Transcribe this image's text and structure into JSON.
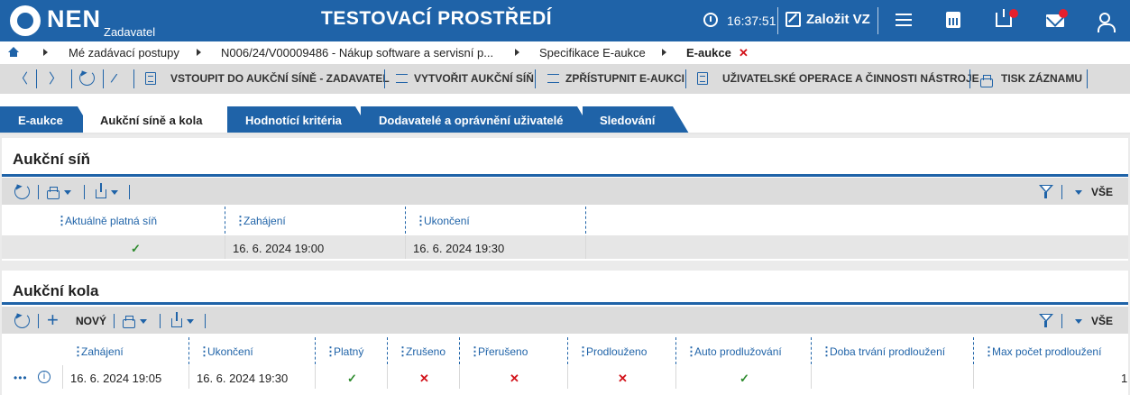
{
  "header": {
    "logo_text": "NEN",
    "logo_sub": "Zadavatel",
    "env_title": "TESTOVACÍ PROSTŘEDÍ",
    "time": "16:37:51",
    "create_label": "Založit VZ"
  },
  "breadcrumb": {
    "items": [
      "Mé zadávací postupy",
      "N006/24/V00009486 - Nákup software a servisní p...",
      "Specifikace E-aukce",
      "E-aukce"
    ],
    "close": "✕"
  },
  "toolbar": {
    "enter": "VSTOUPIT DO AUKČNÍ SÍNĚ - ZADAVATEL",
    "create": "VYTVOŘIT AUKČNÍ SÍŇ",
    "publish": "ZPŘÍSTUPNIT E-AUKCI",
    "ops": "UŽIVATELSKÉ OPERACE A ČINNOSTI NÁSTROJE",
    "print": "TISK ZÁZNAMU"
  },
  "tabs": [
    "E-aukce",
    "Aukční síně a kola",
    "Hodnotící kritéria",
    "Dodavatelé a oprávnění uživatelé",
    "Sledování"
  ],
  "hall": {
    "title": "Aukční síň",
    "all_label": "VŠE",
    "columns": [
      "Aktuálně platná síň",
      "Zahájení",
      "Ukončení"
    ],
    "row": {
      "valid": "✓",
      "start": "16. 6. 2024 19:00",
      "end": "16. 6. 2024 19:30"
    }
  },
  "rounds": {
    "title": "Aukční kola",
    "new_label": "NOVÝ",
    "all_label": "VŠE",
    "columns": [
      "Zahájení",
      "Ukončení",
      "Platný",
      "Zrušeno",
      "Přerušeno",
      "Prodlouženo",
      "Auto prodlužování",
      "Doba trvání prodloužení",
      "Max počet prodloužení"
    ],
    "row": {
      "dots": "•••",
      "info": "i",
      "start": "16. 6. 2024 19:05",
      "end": "16. 6. 2024 19:30",
      "valid": "✓",
      "cancelled": "✕",
      "interrupted": "✕",
      "extended": "✕",
      "auto_extend": "✓",
      "extension_duration": "",
      "max_extensions": "1"
    }
  }
}
